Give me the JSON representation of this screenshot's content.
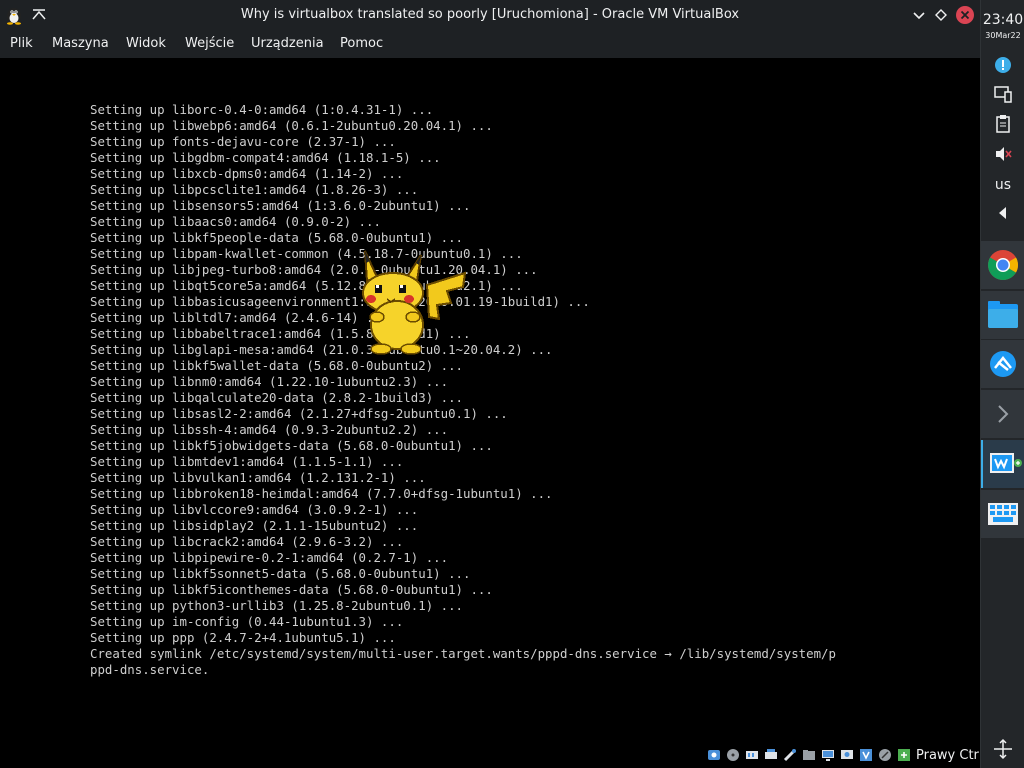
{
  "window": {
    "title": "Why is virtualbox translated so poorly [Uruchomiona] - Oracle VM VirtualBox"
  },
  "menu": [
    "Plik",
    "Maszyna",
    "Widok",
    "Wejście",
    "Urządzenia",
    "Pomoc"
  ],
  "terminal": {
    "lines": [
      "Setting up liborc-0.4-0:amd64 (1:0.4.31-1) ...",
      "Setting up libwebp6:amd64 (0.6.1-2ubuntu0.20.04.1) ...",
      "Setting up fonts-dejavu-core (2.37-1) ...",
      "Setting up libgdbm-compat4:amd64 (1.18.1-5) ...",
      "Setting up libxcb-dpms0:amd64 (1.14-2) ...",
      "Setting up libpcsclite1:amd64 (1.8.26-3) ...",
      "Setting up libsensors5:amd64 (1:3.6.0-2ubuntu1) ...",
      "Setting up libaacs0:amd64 (0.9.0-2) ...",
      "Setting up libkf5people-data (5.68.0-0ubuntu1) ...",
      "Setting up libpam-kwallet-common (4.5.18.7-0ubuntu0.1) ...",
      "Setting up libjpeg-turbo8:amd64 (2.0.3-0ubuntu1.20.04.1) ...",
      "Setting up libqt5core5a:amd64 (5.12.8+dfsg-0ubuntu2.1) ...",
      "Setting up libbasicusageenvironment1:amd64 (2020.01.19-1build1) ...",
      "Setting up libltdl7:amd64 (2.4.6-14) ...",
      "Setting up libbabeltrace1:amd64 (1.5.8-1build1) ...",
      "Setting up libglapi-mesa:amd64 (21.0.3-0ubuntu0.1~20.04.2) ...",
      "Setting up libkf5wallet-data (5.68.0-0ubuntu2) ...",
      "Setting up libnm0:amd64 (1.22.10-1ubuntu2.3) ...",
      "Setting up libqalculate20-data (2.8.2-1build3) ...",
      "Setting up libsasl2-2:amd64 (2.1.27+dfsg-2ubuntu0.1) ...",
      "Setting up libssh-4:amd64 (0.9.3-2ubuntu2.2) ...",
      "Setting up libkf5jobwidgets-data (5.68.0-0ubuntu1) ...",
      "Setting up libmtdev1:amd64 (1.1.5-1.1) ...",
      "Setting up libvulkan1:amd64 (1.2.131.2-1) ...",
      "Setting up libbroken18-heimdal:amd64 (7.7.0+dfsg-1ubuntu1) ...",
      "Setting up libvlccore9:amd64 (3.0.9.2-1) ...",
      "Setting up libsidplay2 (2.1.1-15ubuntu2) ...",
      "Setting up libcrack2:amd64 (2.9.6-3.2) ...",
      "Setting up libpipewire-0.2-1:amd64 (0.2.7-1) ...",
      "Setting up libkf5sonnet5-data (5.68.0-0ubuntu1) ...",
      "Setting up libkf5iconthemes-data (5.68.0-0ubuntu1) ...",
      "Setting up python3-urllib3 (1.25.8-2ubuntu0.1) ...",
      "Setting up im-config (0.44-1ubuntu1.3) ...",
      "Setting up ppp (2.4.7-2+4.1ubuntu5.1) ...",
      "Created symlink /etc/systemd/system/multi-user.target.wants/pppd-dns.service → /lib/systemd/system/p",
      "ppd-dns.service."
    ]
  },
  "statusbar": {
    "host_key": "Prawy Ctrl"
  },
  "panel": {
    "time": "23:40",
    "date": "30Mar22",
    "keyboard_layout": "us",
    "tasks": [
      "chrome-icon",
      "files-icon",
      "remote-desktop-icon",
      "terminal-icon",
      "virtualbox-icon",
      "keyboard-icon"
    ]
  },
  "colors": {
    "titlebar": "#1e2124",
    "panel": "#232629",
    "accent": "#3daee9",
    "close": "#da4453",
    "terminal_text": "#cfcfcf"
  }
}
